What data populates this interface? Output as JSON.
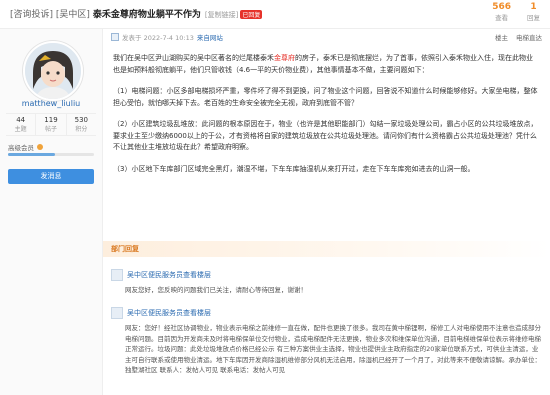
{
  "header": {
    "category": "[咨询投诉] [吴中区]",
    "title": "泰禾金尊府物业躺平不作为",
    "copy_link": "[复制链接]",
    "badge": "已回复",
    "stats": [
      {
        "value": "566",
        "label": "查看"
      },
      {
        "value": "1",
        "label": "回复"
      }
    ]
  },
  "sidebar": {
    "username": "matthew_liuliu",
    "stats": [
      {
        "value": "44",
        "label": "主题"
      },
      {
        "value": "119",
        "label": "帖子"
      },
      {
        "value": "530",
        "label": "积分"
      }
    ],
    "level": "高级会员",
    "progress": 0.55,
    "pm_button": "发消息"
  },
  "post": {
    "meta_prefix": "发表于 2022-7-4 10:13",
    "meta_from": "来自网站",
    "meta_right": [
      "楼主",
      "电梯直达"
    ],
    "paragraphs": [
      {
        "pre": "我们在吴中区尹山湖购买的吴中区著名的烂尾楼泰禾",
        "hl": "金尊府",
        "post": "的房子，泰禾已是彻底摆烂，为了首事，依照引入泰禾物业入住，现在此物业也是如预料般彻底躺平，他们只管收钱（4.6一平的天价物业费），其他事情基本不做，主要问题如下："
      },
      {
        "pre": "（1）电梯问题：小区多部电梯损坏严重，零件坏了得不到更换，问了物业这个问题，回答说不知道什么时候能够修好。大家坐电梯，整体担心受怕，就怕哪天掉下去。老百姓的生命安全被完全无视，政府到底管不管？",
        "hl": "",
        "post": ""
      },
      {
        "pre": "（2）小区建筑垃圾乱堆放：此问题的根本原因在于，物业（也许是其他职能部门）勾结一家垃圾处理公司，霸占小区的公共垃圾堆放点，要求业主至少缴纳6000以上的于公，才有资格将自家的建筑垃圾放在公共垃圾处理池。请问你们有什么资格霸占公共垃圾处理池？凭什么不让其他业主堆放垃圾在此？希望政府明察。",
        "hl": "",
        "post": ""
      },
      {
        "pre": "（3）小区地下车库部门区域完全黑灯，潮湿不堪，下车车库抽湿机从来打开过，走在下车车库宛如进去的山洞一般。",
        "hl": "",
        "post": ""
      }
    ]
  },
  "replies": {
    "banner": "部门回复",
    "items": [
      {
        "author": "吴中区便民服务员查看楼层",
        "text": "网友您好，您反映的问题我们已关注，请耐心等待回复，谢谢！"
      },
      {
        "author": "吴中区便民服务员查看楼层",
        "text": "网友：您好！经社区协调物业，物业表示电梯之前维修一直在做，配件也更换了很多。我司在黄中梯锂啊，梯修工人对电梯使用不注意也造成部分电梯问题。目前因为开发商未及时将电梯保单位交付物业，造成电梯配件无法更换，物业多次和维保单位沟通，目前电梯维保单位表示将维修电梯正常运行。垃圾问题：此处垃圾堆放点价格已经公示 有三种方案供业主选择，物业也提供业主政府指定的20家单位联系方式，可供业主清运，业主可自行联系或使用物业清运。地下车库因开发商除湿机维修部分风机无法启用，除湿机已经开了一个月了，对此等来不便敬请谅解。承办单位：独墅湖社区 联系人：发帖人可见 联系电话：发帖人可见"
      }
    ]
  }
}
